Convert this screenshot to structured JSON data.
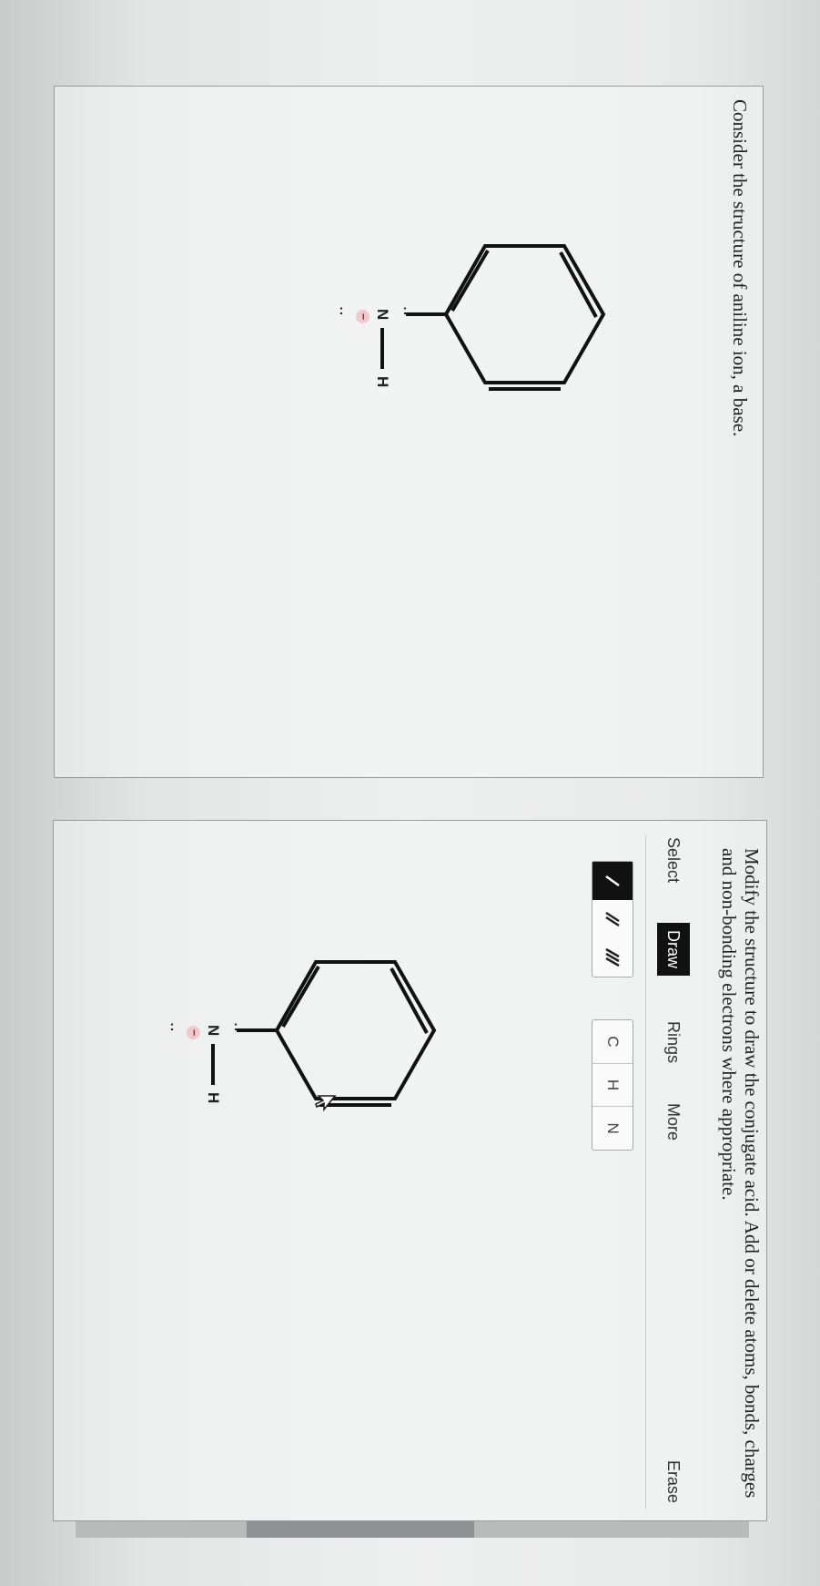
{
  "left_panel": {
    "prompt": "Consider the structure of aniline ion, a base.",
    "molecule": {
      "nitrogen": "N",
      "hydrogen": "H",
      "charge": "−",
      "lone_pair_top": ":",
      "lone_pair_bottom": ":"
    }
  },
  "right_panel": {
    "instructions": "Modify the structure to draw the conjugate acid. Add or delete atoms, bonds, charges and non-bonding electrons where appropriate.",
    "tabs": [
      {
        "label": "Select",
        "active": false
      },
      {
        "label": "Draw",
        "active": true
      },
      {
        "label": "Rings",
        "active": false
      },
      {
        "label": "More",
        "active": false
      },
      {
        "label": "Erase",
        "active": false
      }
    ],
    "bond_tools": [
      {
        "icon": "single-bond-icon",
        "selected": true
      },
      {
        "icon": "double-bond-icon",
        "selected": false
      },
      {
        "icon": "triple-bond-icon",
        "selected": false
      }
    ],
    "atom_tools": [
      "C",
      "H",
      "N"
    ],
    "molecule": {
      "nitrogen": "N",
      "hydrogen": "H",
      "charge": "−",
      "lone_pair_top": ":",
      "lone_pair_bottom": ":"
    }
  },
  "colors": {
    "active_tab_bg": "#111111",
    "charge_badge": "#f0c9cc",
    "bond_color": "#111111"
  }
}
